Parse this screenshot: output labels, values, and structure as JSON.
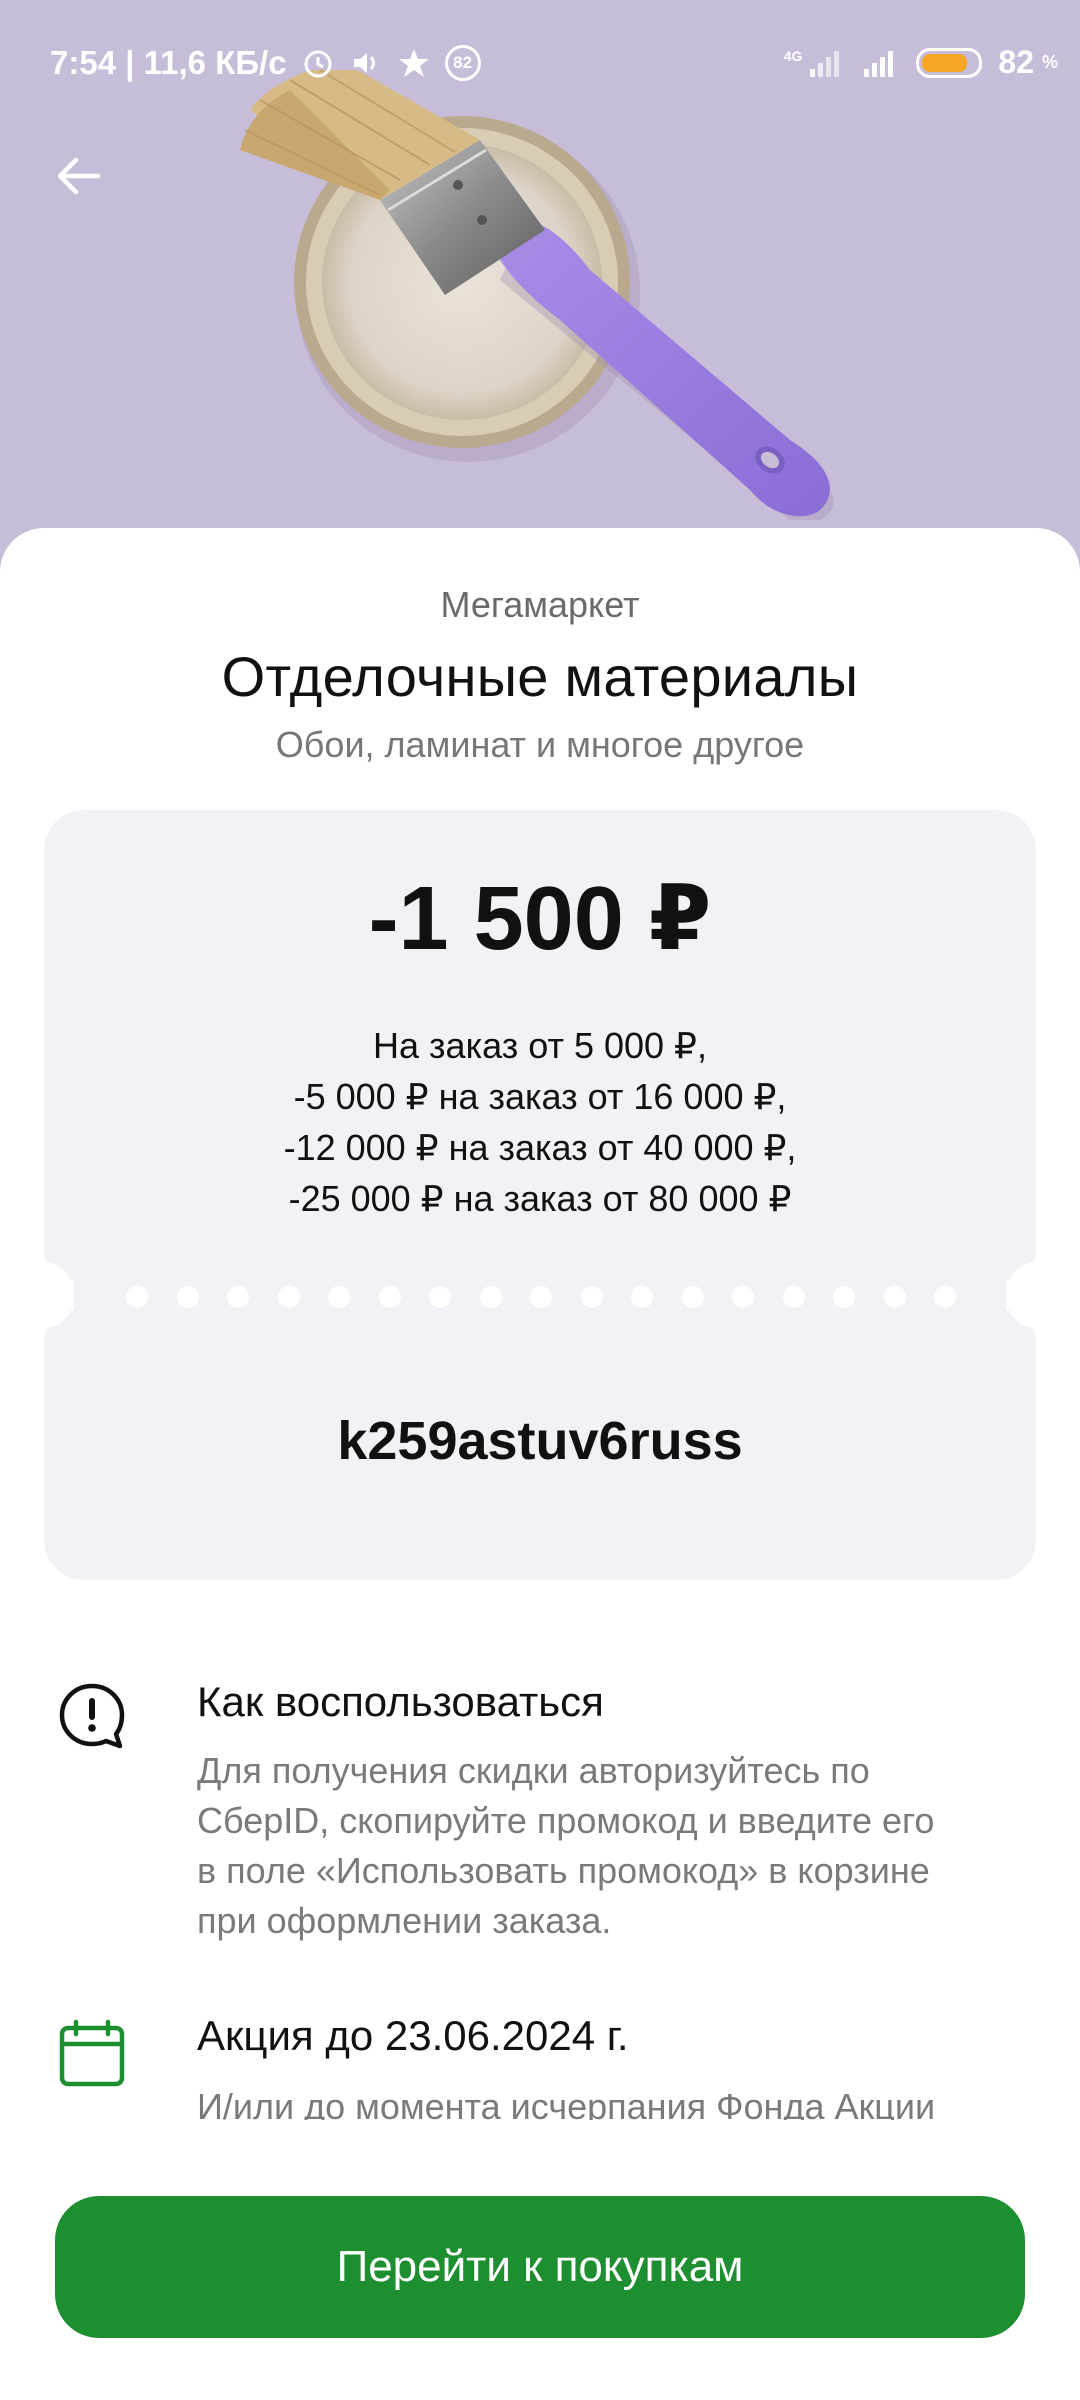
{
  "status_bar": {
    "time_and_speed": "7:54 | 11,6 КБ/с",
    "notification_badge": "82",
    "network": "4G",
    "battery_percent": "82",
    "battery_unit": "%",
    "battery_level": 0.82,
    "battery_color": "#f5a623"
  },
  "header": {
    "background_color": "#c8bdd9",
    "back_icon": "arrow-left-icon",
    "hero_image": "paint-brush-on-paint-can"
  },
  "offer": {
    "shop": "Мегамаркет",
    "title": "Отделочные материалы",
    "subtitle": "Обои, ламинат и многое другое",
    "amount": "-1 500 ₽",
    "conditions": [
      "На заказ от 5 000 ₽,",
      "-5 000 ₽ на заказ от 16 000 ₽,",
      "-12 000 ₽ на заказ от 40 000 ₽,",
      "-25 000 ₽ на заказ от 80 000 ₽"
    ],
    "promocode": "k259astuv6russ"
  },
  "how_to_use": {
    "icon": "exclamation-bubble-icon",
    "heading": "Как воспользоваться",
    "text_lines": [
      "Для получения скидки авторизуйтесь по",
      "СберID, скопируйте промокод и введите его",
      "в поле «Использовать промокод» в корзине",
      "при оформлении заказа."
    ]
  },
  "validity": {
    "icon": "calendar-icon",
    "heading": "Акция до 23.06.2024 г.",
    "text_line": "И/или до момента исчерпания Фонда Акции"
  },
  "cta": {
    "label": "Перейти к покупкам",
    "color": "#1e8f31"
  }
}
